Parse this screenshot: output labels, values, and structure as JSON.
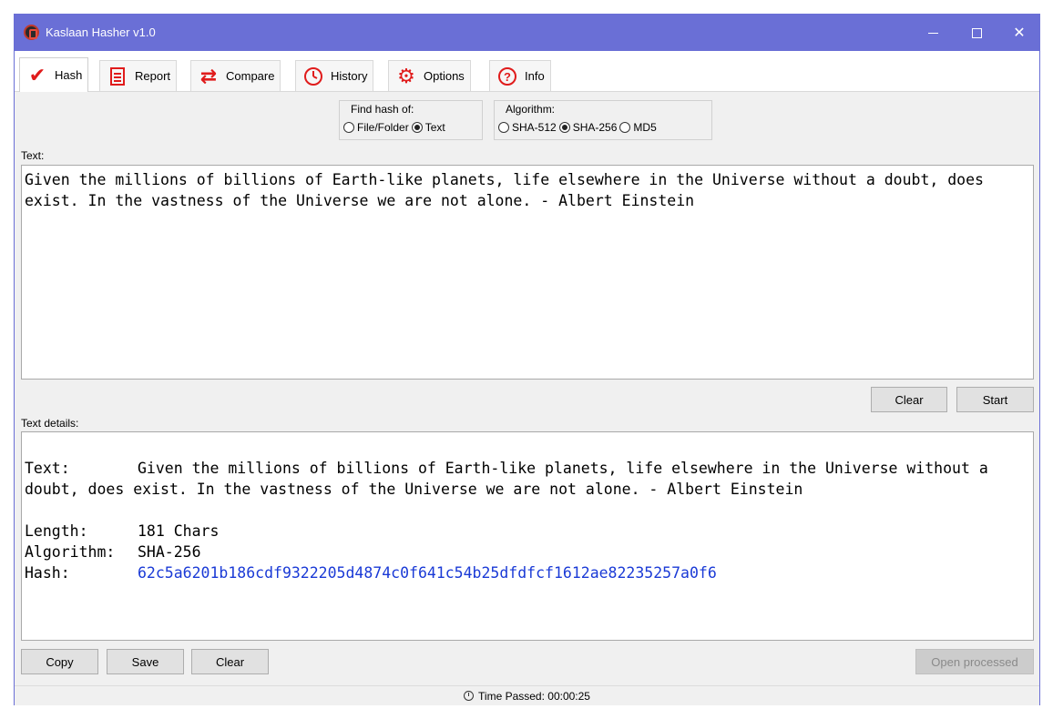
{
  "window": {
    "title": "Kaslaan Hasher v1.0",
    "accent_color": "#6a6fd6"
  },
  "tabs": [
    {
      "label": "Hash",
      "icon": "checkmark-icon",
      "active": true
    },
    {
      "label": "Report",
      "icon": "report-icon",
      "active": false
    },
    {
      "label": "Compare",
      "icon": "compare-arrows-icon",
      "active": false
    },
    {
      "label": "History",
      "icon": "clock-icon",
      "active": false
    },
    {
      "label": "Options",
      "icon": "gear-icon",
      "active": false
    },
    {
      "label": "Info",
      "icon": "question-icon",
      "active": false
    }
  ],
  "find_hash_of": {
    "title": "Find hash of:",
    "options": [
      "File/Folder",
      "Text"
    ],
    "selected": "Text"
  },
  "algorithm": {
    "title": "Algorithm:",
    "options": [
      "SHA-512",
      "SHA-256",
      "MD5"
    ],
    "selected": "SHA-256"
  },
  "input": {
    "label": "Text:",
    "value": "Given the millions of billions of Earth-like planets, life elsewhere in the Universe without a doubt, does exist. In the vastness of the Universe we are not alone. - Albert Einstein",
    "clear_label": "Clear",
    "start_label": "Start"
  },
  "details": {
    "label": "Text details:",
    "text_key": "Text:",
    "text_value": "Given the millions of billions of Earth-like planets, life elsewhere in the Universe without a doubt, does exist. In the vastness of the Universe we are not alone. - Albert Einstein",
    "length_key": "Length:",
    "length_value": "181 Chars",
    "algorithm_key": "Algorithm:",
    "algorithm_value": "SHA-256",
    "hash_key": "Hash:",
    "hash_value": "62c5a6201b186cdf9322205d4874c0f641c54b25dfdfcf1612ae82235257a0f6",
    "hash_color": "#1a3ad6"
  },
  "bottom_buttons": {
    "copy": "Copy",
    "save": "Save",
    "clear": "Clear",
    "open_processed": "Open processed"
  },
  "status": {
    "time_passed": "Time Passed: 00:00:25"
  }
}
